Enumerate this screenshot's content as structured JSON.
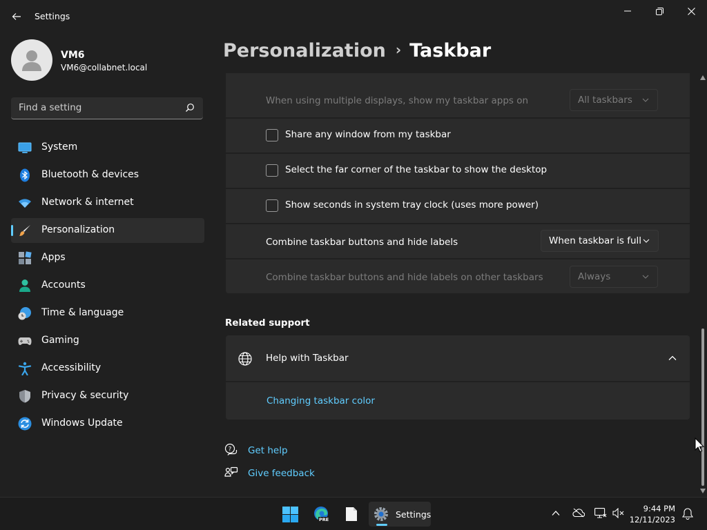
{
  "window": {
    "title": "Settings"
  },
  "user": {
    "name": "VM6",
    "email": "VM6@collabnet.local"
  },
  "search": {
    "placeholder": "Find a setting"
  },
  "sidebar": {
    "items": [
      {
        "label": "System",
        "icon": "system-icon"
      },
      {
        "label": "Bluetooth & devices",
        "icon": "bluetooth-icon"
      },
      {
        "label": "Network & internet",
        "icon": "wifi-icon"
      },
      {
        "label": "Personalization",
        "icon": "brush-icon",
        "active": true
      },
      {
        "label": "Apps",
        "icon": "apps-icon"
      },
      {
        "label": "Accounts",
        "icon": "person-icon"
      },
      {
        "label": "Time & language",
        "icon": "globe-clock-icon"
      },
      {
        "label": "Gaming",
        "icon": "gamepad-icon"
      },
      {
        "label": "Accessibility",
        "icon": "accessibility-icon"
      },
      {
        "label": "Privacy & security",
        "icon": "shield-icon"
      },
      {
        "label": "Windows Update",
        "icon": "update-icon"
      }
    ]
  },
  "breadcrumb": {
    "parent": "Personalization",
    "separator": "›",
    "current": "Taskbar"
  },
  "settings": {
    "multi_display_label": "When using multiple displays, show my taskbar apps on",
    "multi_display_value": "All taskbars",
    "share_window_label": "Share any window from my taskbar",
    "share_window_checked": false,
    "far_corner_label": "Select the far corner of the taskbar to show the desktop",
    "far_corner_checked": false,
    "show_seconds_label": "Show seconds in system tray clock (uses more power)",
    "show_seconds_checked": false,
    "combine_label": "Combine taskbar buttons and hide labels",
    "combine_value": "When taskbar is full",
    "combine_other_label": "Combine taskbar buttons and hide labels on other taskbars",
    "combine_other_value": "Always"
  },
  "related_support": {
    "title": "Related support",
    "help_title": "Help with Taskbar",
    "help_link": "Changing taskbar color"
  },
  "footer_links": {
    "get_help": "Get help",
    "give_feedback": "Give feedback"
  },
  "taskbar": {
    "active_app_label": "Settings",
    "edge_badge": "PRE",
    "time": "9:44 PM",
    "date": "12/11/2023"
  },
  "colors": {
    "accent": "#60cdff",
    "background": "#202020",
    "card": "#2b2b2b"
  }
}
